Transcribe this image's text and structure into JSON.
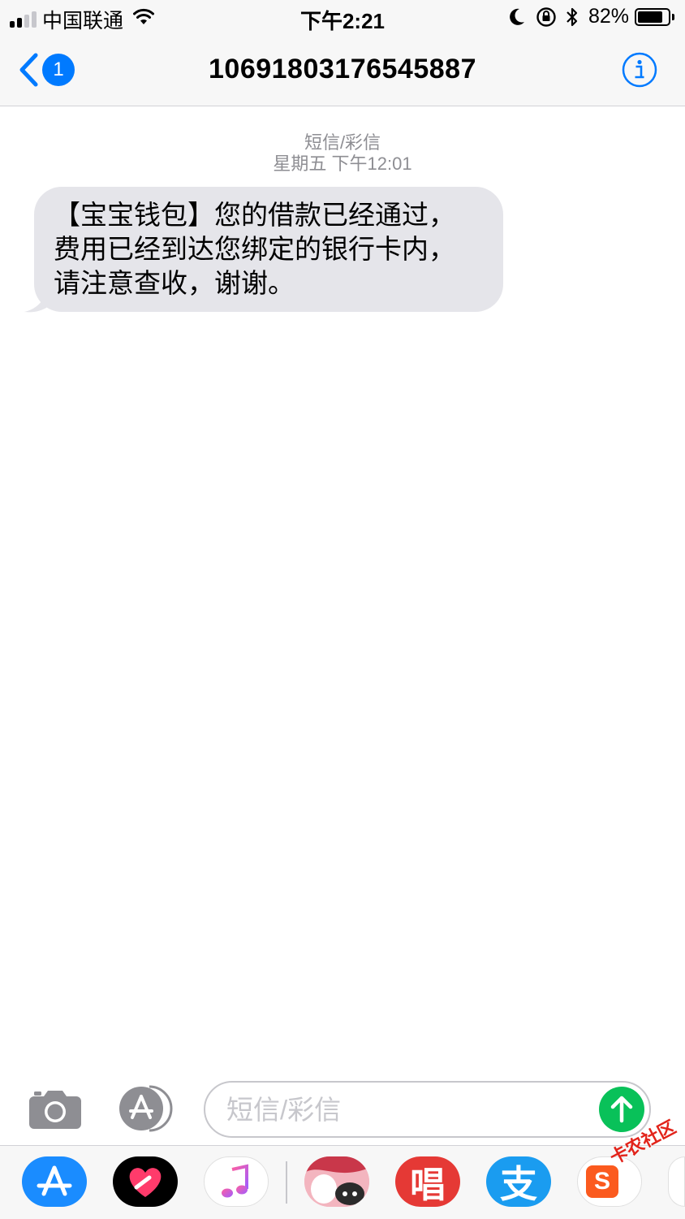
{
  "status_bar": {
    "carrier": "中国联通",
    "time": "下午2:21",
    "battery_percent_label": "82%",
    "battery_level": 0.82,
    "signal_bars_on": 2,
    "signal_bars_total": 4
  },
  "nav": {
    "back_badge": "1",
    "title": "10691803176545887",
    "accent_color": "#007aff"
  },
  "conversation": {
    "service_label": "短信/彩信",
    "timestamp": "星期五 下午12:01",
    "messages": [
      {
        "direction": "incoming",
        "lines": [
          "【宝宝钱包】您的借款已经通过，",
          "费用已经到达您绑定的银行卡内，",
          "请注意查收，谢谢。"
        ]
      }
    ]
  },
  "input_bar": {
    "placeholder": "短信/彩信",
    "send_color": "#09c159"
  },
  "app_drawer": {
    "apps": [
      {
        "icon": "app-store-icon"
      },
      {
        "icon": "digital-touch-icon"
      },
      {
        "icon": "music-icon"
      },
      {
        "icon": "sticker-animal-icon"
      },
      {
        "icon": "sing-app-icon",
        "glyph": "唱"
      },
      {
        "icon": "alipay-icon",
        "glyph": "支"
      },
      {
        "icon": "sogou-input-icon",
        "glyph": "S"
      }
    ]
  },
  "watermark": {
    "text": "卡农社区"
  }
}
